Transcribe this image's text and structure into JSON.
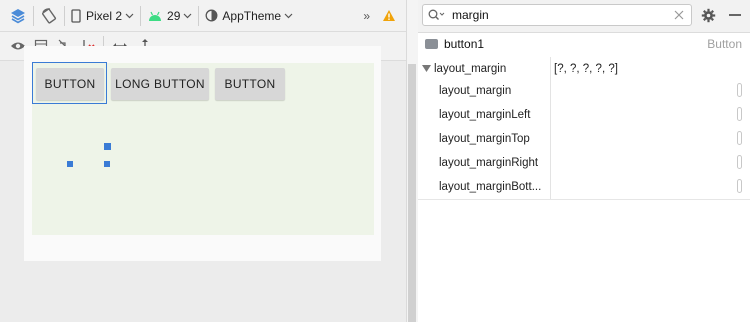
{
  "toolbar": {
    "device": "Pixel 2",
    "api_level": "29",
    "theme": "AppTheme",
    "overflow": "»"
  },
  "canvas": {
    "buttons": [
      "BUTTON",
      "LONG BUTTON",
      "BUTTON"
    ]
  },
  "attributes": {
    "search_value": "margin",
    "component_name": "button1",
    "component_type": "Button",
    "group": {
      "label": "layout_margin",
      "value": "[?, ?, ?, ?, ?]"
    },
    "rows": [
      {
        "label": "layout_margin"
      },
      {
        "label": "layout_marginLeft"
      },
      {
        "label": "layout_marginTop"
      },
      {
        "label": "layout_marginRight"
      },
      {
        "label": "layout_marginBott..."
      }
    ]
  },
  "colors": {
    "selection": "#3a7bd5",
    "warning": "#f0a30a",
    "android_green": "#3ddc84",
    "layers_blue": "#4a8bd8"
  },
  "icons": [
    "layers-icon",
    "rotate-icon",
    "phone-icon",
    "android-icon",
    "theme-icon",
    "warning-icon",
    "eye-icon",
    "blueprint-icon",
    "constraint-off-icon",
    "clear-constraints-icon",
    "horizontal-expand-icon",
    "vertical-expand-icon",
    "search-icon",
    "clear-icon",
    "gear-icon",
    "minimize-icon"
  ]
}
